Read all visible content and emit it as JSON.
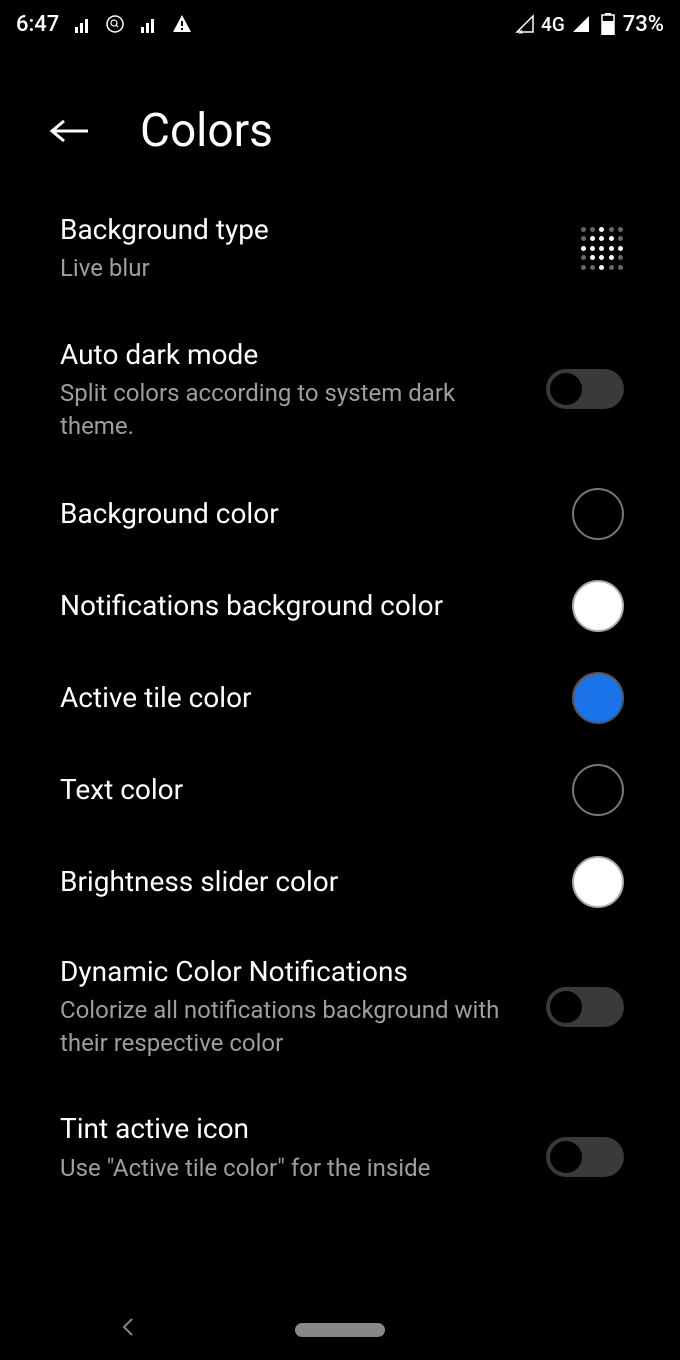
{
  "status": {
    "time": "6:47",
    "network": "4G",
    "battery": "73%"
  },
  "header": {
    "title": "Colors"
  },
  "settings": {
    "bg_type": {
      "title": "Background type",
      "sub": "Live blur"
    },
    "auto_dark": {
      "title": "Auto dark mode",
      "sub": "Split colors according to system dark theme."
    },
    "bg_color": {
      "title": "Background color",
      "color": "#000000"
    },
    "notif_bg": {
      "title": "Notifications background color",
      "color": "#ffffff"
    },
    "active_tile": {
      "title": "Active tile color",
      "color": "#1a73e8"
    },
    "text_color": {
      "title": "Text color",
      "color": "#000000"
    },
    "brightness": {
      "title": "Brightness slider color",
      "color": "#ffffff"
    },
    "dyn_color": {
      "title": "Dynamic Color Notifications",
      "sub": "Colorize all notifications background with their respective color"
    },
    "tint_icon": {
      "title": "Tint active icon",
      "sub": "Use \"Active tile color\" for the inside"
    }
  }
}
